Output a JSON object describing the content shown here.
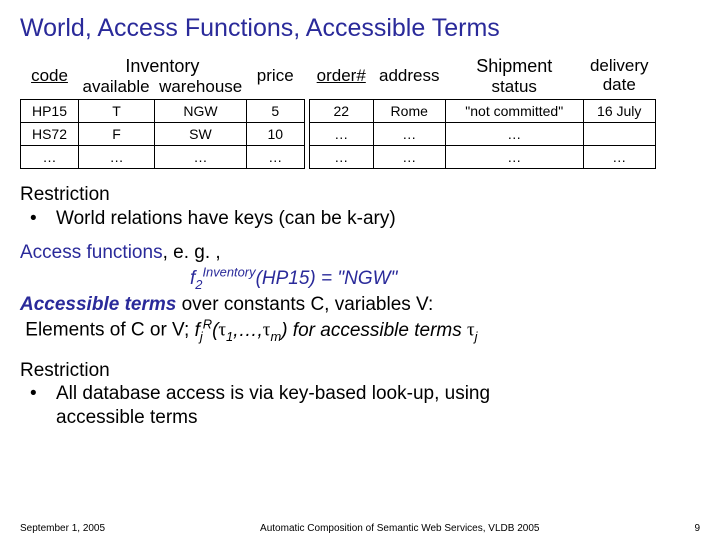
{
  "title": "World, Access Functions, Accessible Terms",
  "inventory": {
    "name": "Inventory",
    "headers": {
      "code": "code",
      "available": "available",
      "warehouse": "warehouse",
      "price": "price"
    },
    "rows": [
      {
        "code": "HP15",
        "available": "T",
        "warehouse": "NGW",
        "price": "5"
      },
      {
        "code": "HS72",
        "available": "F",
        "warehouse": "SW",
        "price": "10"
      },
      {
        "code": "…",
        "available": "…",
        "warehouse": "…",
        "price": "…"
      }
    ]
  },
  "shipment": {
    "name": "Shipment",
    "headers": {
      "order": "order#",
      "address": "address",
      "status": "status",
      "delivery": "delivery date"
    },
    "rows": [
      {
        "order": "22",
        "address": "Rome",
        "status": "\"not committed\"",
        "delivery": "16 July"
      },
      {
        "order": "…",
        "address": "…",
        "status": "…",
        "delivery": ""
      },
      {
        "order": "…",
        "address": "…",
        "status": "…",
        "delivery": "…"
      }
    ]
  },
  "body": {
    "restriction1_label": "Restriction",
    "restriction1_text": "World relations have keys (can be k-ary)",
    "access_label": "Access functions",
    "access_eg": ", e. g. ,",
    "func_f": "f",
    "func_sub2": "2",
    "func_supInv": "Inventory",
    "func_argHP": "(HP15) = \"NGW\"",
    "accessible_terms_label": "Accessible terms",
    "accessible_over": " over constants C, variables V:",
    "elements_line_a": "Elements of C or V;  ",
    "tau1": "1",
    "ellipsis": ",…,",
    "taum": "m",
    "for_terms": ") for accessible terms ",
    "tauj": "j",
    "sup_R": "R",
    "sub_j": "j",
    "restriction2_label": "Restriction",
    "restriction2_text1": "All database access is via key-based look-up, using",
    "restriction2_text2": "accessible terms"
  },
  "footer": {
    "date": "September 1, 2005",
    "conf": "Automatic Composition of Semantic Web Services, VLDB 2005",
    "page": "9"
  },
  "bullet": "•",
  "tau": "τ"
}
